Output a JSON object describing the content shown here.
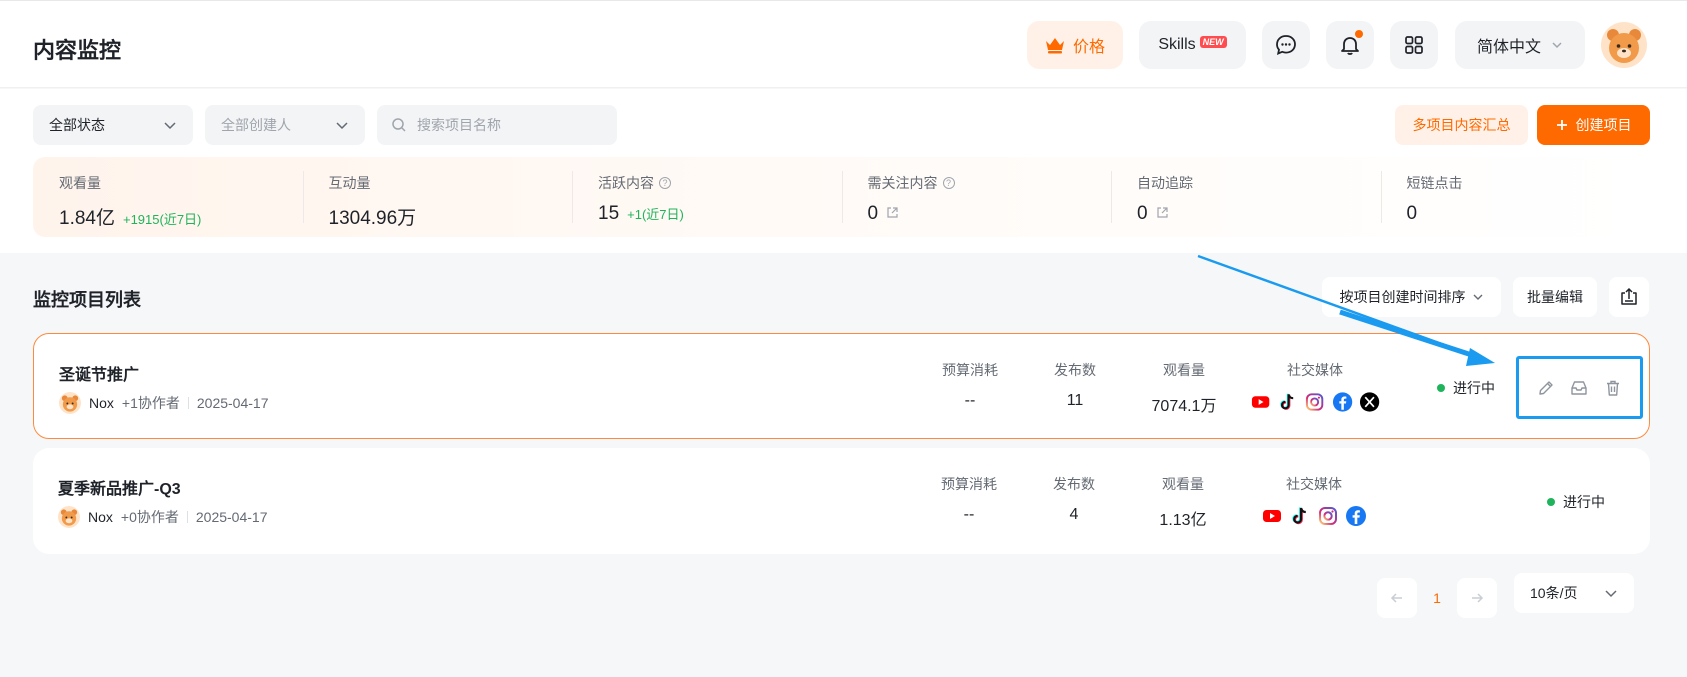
{
  "header": {
    "title": "内容监控",
    "price_label": "价格",
    "skills_label": "Skills",
    "skills_badge": "NEW",
    "language": "简体中文"
  },
  "filters": {
    "status": "全部状态",
    "creator": "全部创建人",
    "search_placeholder": "搜索项目名称",
    "multi_summary": "多项目内容汇总",
    "create": "创建项目"
  },
  "stats": [
    {
      "label": "观看量",
      "value": "1.84亿",
      "delta": "+1915(近7日)"
    },
    {
      "label": "互动量",
      "value": "1304.96万",
      "delta": ""
    },
    {
      "label": "活跃内容",
      "value": "15",
      "delta": "+1(近7日)"
    },
    {
      "label": "需关注内容",
      "value": "0",
      "delta": ""
    },
    {
      "label": "自动追踪",
      "value": "0",
      "delta": ""
    },
    {
      "label": "短链点击",
      "value": "0",
      "delta": ""
    }
  ],
  "list": {
    "title": "监控项目列表",
    "sort": "按项目创建时间排序",
    "batch_edit": "批量编辑",
    "col_budget": "预算消耗",
    "col_posts": "发布数",
    "col_views": "观看量",
    "col_social": "社交媒体"
  },
  "projects": [
    {
      "name": "圣诞节推广",
      "owner": "Nox",
      "collab": "+1协作者",
      "date": "2025-04-17",
      "budget": "--",
      "posts": "11",
      "views": "7074.1万",
      "status": "进行中"
    },
    {
      "name": "夏季新品推广-Q3",
      "owner": "Nox",
      "collab": "+0协作者",
      "date": "2025-04-17",
      "budget": "--",
      "posts": "4",
      "views": "1.13亿",
      "status": "进行中"
    }
  ],
  "pagination": {
    "current": "1",
    "page_size": "10条/页"
  },
  "colors": {
    "accent": "#ff6a00",
    "success": "#1fb35b",
    "annotation": "#1a9bf0"
  }
}
